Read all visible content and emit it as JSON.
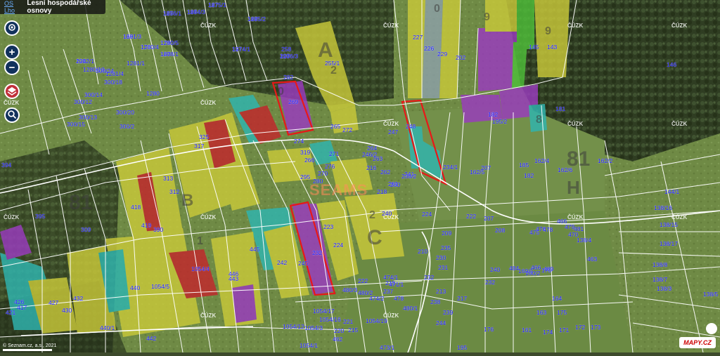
{
  "header": {
    "tag": "OS Lho",
    "title": "Lesní hospodářské osnovy"
  },
  "controls": {
    "locate": "locate-icon",
    "zoom_in": "+",
    "zoom_out": "−",
    "layers": "layers-icon",
    "search": "search-icon"
  },
  "watermark": "SEAMS",
  "provider": "MAPY.CZ",
  "copyright": "© Seznam.cz, a.s., 2021",
  "uzk_labels": [
    "ČÚZK",
    "ČÚZK",
    "ČÚZK",
    "ČÚZK",
    "ČÚZK",
    "ČÚZK",
    "ČÚZK",
    "ČÚZK",
    "ČÚZK",
    "ČÚZK",
    "ČÚZK",
    "ČÚZK",
    "ČÚZK",
    "ČÚZK",
    "ČÚZK",
    "ČÚZK"
  ],
  "big_letters": [
    "A",
    "B",
    "C",
    "81",
    "81",
    "H",
    "0",
    "9",
    "9",
    "8",
    "0",
    "2",
    "1",
    "2"
  ],
  "parcels": [
    "1276/1",
    "1274/3",
    "1275/1",
    "1275/2",
    "1281/3",
    "1280/4",
    "1280/5",
    "1278/1",
    "1274/1",
    "1276/3",
    "1282/1",
    "1281/1",
    "1280/10",
    "1281/4",
    "300/24",
    "300/18",
    "300/14",
    "300/12",
    "300/20",
    "300/15",
    "300/2",
    "300/13",
    "1280",
    "282",
    "255/1",
    "258",
    "269",
    "265",
    "247",
    "248",
    "227",
    "226",
    "229",
    "202",
    "146",
    "145",
    "143",
    "195/2",
    "182",
    "181",
    "182",
    "185",
    "162/4",
    "162/5",
    "162/6",
    "162/2",
    "144/1",
    "138/16",
    "138/15",
    "138/17",
    "138/8",
    "138/7",
    "138/3",
    "138/5",
    "138/4",
    "170",
    "171",
    "172",
    "173",
    "174",
    "175",
    "176",
    "195",
    "240",
    "232",
    "213",
    "217",
    "238",
    "239",
    "244",
    "241",
    "224",
    "238/2",
    "234/1",
    "246/2",
    "207",
    "222",
    "207",
    "208",
    "209",
    "210",
    "230",
    "231",
    "232",
    "235",
    "237",
    "215",
    "480/3",
    "480/2",
    "474/2",
    "474/1",
    "473/1",
    "471/1",
    "478",
    "480/1",
    "1054/19",
    "1054/17",
    "1054/16",
    "1054/12",
    "1054/3",
    "1054/1",
    "1054/5",
    "1054/4",
    "443",
    "445",
    "446",
    "440",
    "442",
    "440/1",
    "432",
    "430",
    "427",
    "426",
    "421",
    "417",
    "418",
    "419",
    "390",
    "394",
    "395",
    "309",
    "312",
    "313",
    "325",
    "317",
    "319",
    "295",
    "266",
    "280",
    "270",
    "271",
    "274",
    "276",
    "272",
    "264",
    "263",
    "262",
    "261",
    "260",
    "218",
    "216",
    "240",
    "242",
    "245",
    "232",
    "224",
    "223",
    "222",
    "221",
    "220",
    "215",
    "462",
    "463",
    "466",
    "466",
    "470",
    "475",
    "476",
    "478",
    "479",
    "481",
    "489",
    "484",
    "160/1",
    "160/2",
    "161",
    "163",
    "164",
    "165",
    "166",
    "167",
    "168",
    "169",
    "178",
    "179",
    "180",
    "197",
    "200",
    "201"
  ],
  "colors": {
    "header_bg": "#141414",
    "control_bg": "#12325c",
    "parcel_label": "#1414ff",
    "highlight": "#e81818",
    "stand_yellow": "#c9c93a",
    "stand_cyan": "#2fb5b0",
    "stand_purple": "#9a3bbf",
    "stand_red": "#c2272c",
    "stand_green": "#4fbf3a"
  }
}
